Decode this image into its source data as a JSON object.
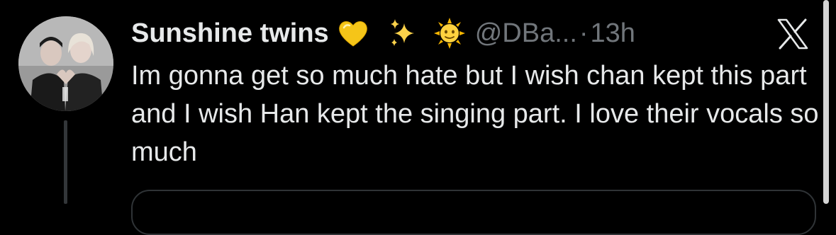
{
  "tweet": {
    "author": {
      "display_name": "Sunshine twins",
      "name_emojis": [
        "yellow-heart-icon",
        "sparkles-icon",
        "sun-with-face-icon"
      ],
      "handle": "@DBa...",
      "avatar": "avatar-photo"
    },
    "separator": "·",
    "timestamp": "13h",
    "text": "Im gonna get so much hate but I wish chan kept this part and I wish Han kept the singing part. I love their vocals so much",
    "platform_icon": "x-logo-icon"
  },
  "colors": {
    "background": "#000000",
    "text_primary": "#e7e9ea",
    "text_secondary": "#71767b",
    "border": "#2f3336"
  }
}
